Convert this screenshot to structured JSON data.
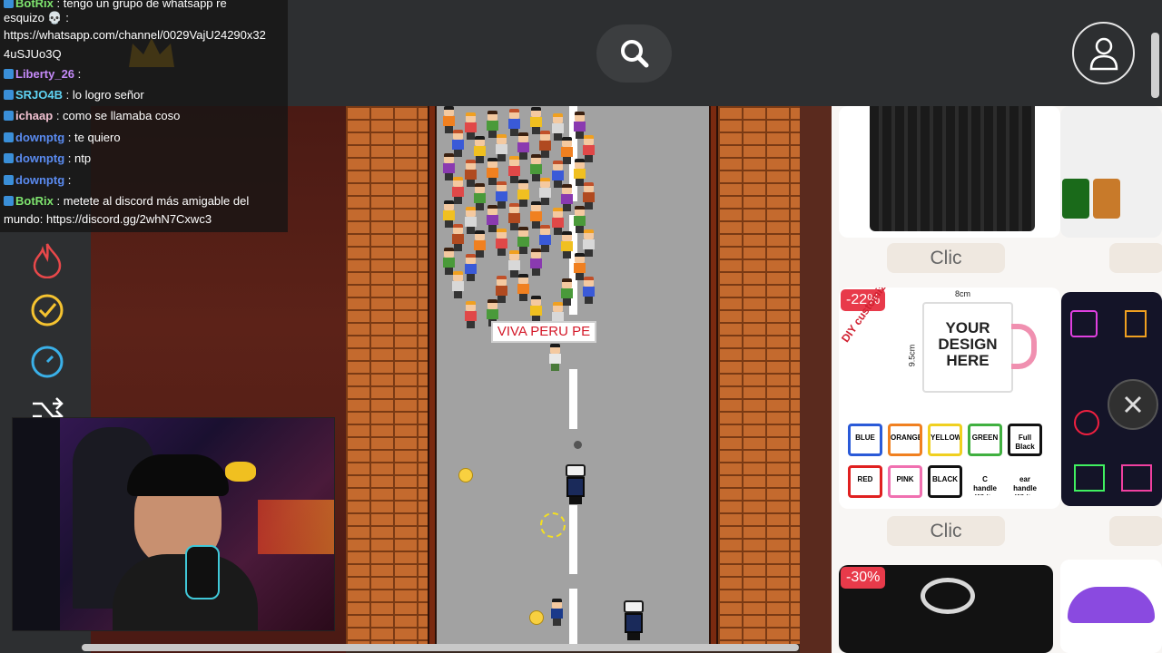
{
  "chat": {
    "messages": [
      {
        "user": "BotRix",
        "text": ": tengo un grupo de whatsapp re",
        "user_color": "#7ee36e"
      },
      {
        "user": "",
        "text": "esquizo 💀 :",
        "user_color": "#ffffff"
      },
      {
        "user": "",
        "text": "https://whatsapp.com/channel/0029VajU24290x32",
        "user_color": "#ffffff"
      },
      {
        "user": "",
        "text": "4uSJUo3Q",
        "user_color": "#ffffff"
      },
      {
        "user": "Liberty_26",
        "text": ":",
        "user_color": "#c58af9"
      },
      {
        "user": "SRJO4B",
        "text": ": lo logro señor",
        "user_color": "#5fd3f3"
      },
      {
        "user": "ichaap",
        "text": ": como se llamaba coso",
        "user_color": "#f0c0d0"
      },
      {
        "user": "downptg",
        "text": ": te quiero",
        "user_color": "#5a8bf0"
      },
      {
        "user": "downptg",
        "text": ": ntp",
        "user_color": "#5a8bf0"
      },
      {
        "user": "downptg",
        "text": ":",
        "user_color": "#5a8bf0"
      },
      {
        "user": "BotRix",
        "text": ": metete al discord más amigable del",
        "user_color": "#7ee36e"
      },
      {
        "user": "",
        "text": "mundo: https://discord.gg/2whN7Cxwc3",
        "user_color": "#ffffff"
      }
    ]
  },
  "game": {
    "sign_text": "VIVA PERU PE"
  },
  "shop": {
    "clic_label": "Clic",
    "discounts": [
      "-22%",
      "-30%"
    ],
    "mug": {
      "title_line1": "YOUR",
      "title_line2": "DESIGN",
      "title_line3": "HERE",
      "diy": "DIY customized",
      "width": "8cm",
      "height": "9.5cm",
      "colors": [
        "BLUE",
        "ORANGE",
        "YELLOW",
        "GREEN",
        "Full Black",
        "RED",
        "PINK",
        "BLACK",
        "C handle White",
        "ear handle White"
      ]
    }
  },
  "colors": {
    "accent_icons": "#f5c330",
    "fire": "#e8484a",
    "timer": "#3ab0e8",
    "topbar": "#2d2f31"
  }
}
